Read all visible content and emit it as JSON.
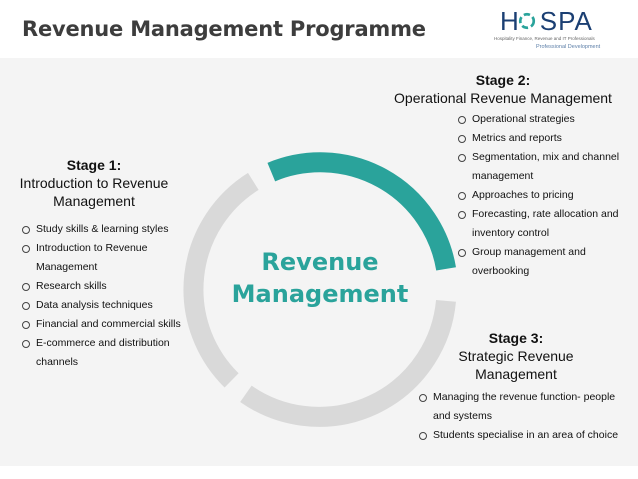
{
  "header": {
    "title": "Revenue Management Programme",
    "logo": {
      "wordmark_left": "H",
      "wordmark_right": "SPA",
      "tagline": "Hospitality Finance, Revenue and IT Professionals",
      "subline": "Professional Development"
    }
  },
  "center": {
    "line1": "Revenue",
    "line2": "Management"
  },
  "stages": [
    {
      "label": "Stage 1:",
      "name": "Introduction to Revenue Management",
      "items": [
        "Study skills & learning styles",
        "Introduction to Revenue Management",
        "Research skills",
        "Data analysis techniques",
        "Financial and commercial skills",
        "E-commerce and distribution channels"
      ]
    },
    {
      "label": "Stage 2:",
      "name": "Operational Revenue Management",
      "items": [
        "Operational strategies",
        "Metrics and reports",
        "Segmentation, mix and channel management",
        "Approaches to pricing",
        "Forecasting, rate allocation and inventory control",
        "Group management and overbooking"
      ]
    },
    {
      "label": "Stage 3:",
      "name": "Strategic Revenue Management",
      "items": [
        "Managing the revenue function- people and systems",
        "Students specialise in an area of choice"
      ]
    }
  ],
  "colors": {
    "accent": "#2aa39b",
    "ring_grey": "#d9d9d9",
    "title": "#3d3d3d",
    "logo_blue": "#1b3f73"
  },
  "icons": [
    "bullet-circle-icon",
    "logo-o-icon"
  ]
}
